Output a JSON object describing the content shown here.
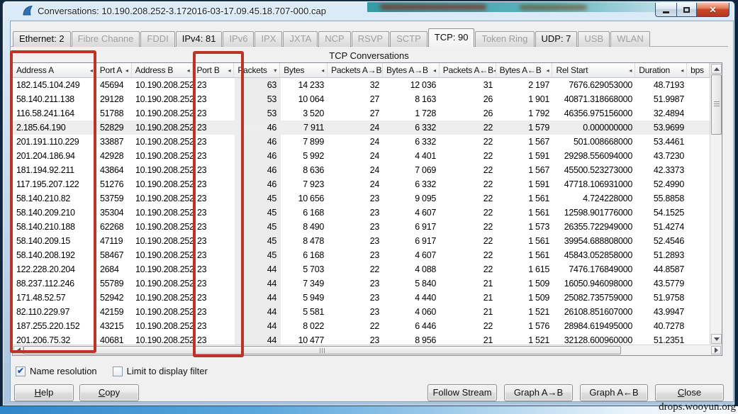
{
  "window": {
    "title": "Conversations: 10.190.208.252-3.172016-03-17.09.45.18.707-000.cap",
    "watermark": "drops.wooyun.org"
  },
  "tabs": [
    {
      "label": "Ethernet: 2",
      "state": "enabled"
    },
    {
      "label": "Fibre Channe",
      "state": "disabled"
    },
    {
      "label": "FDDI",
      "state": "disabled"
    },
    {
      "label": "IPv4: 81",
      "state": "enabled"
    },
    {
      "label": "IPv6",
      "state": "disabled"
    },
    {
      "label": "IPX",
      "state": "disabled"
    },
    {
      "label": "JXTA",
      "state": "disabled"
    },
    {
      "label": "NCP",
      "state": "disabled"
    },
    {
      "label": "RSVP",
      "state": "disabled"
    },
    {
      "label": "SCTP",
      "state": "disabled"
    },
    {
      "label": "TCP: 90",
      "state": "active"
    },
    {
      "label": "Token Ring",
      "state": "disabled"
    },
    {
      "label": "UDP: 7",
      "state": "enabled"
    },
    {
      "label": "USB",
      "state": "disabled"
    },
    {
      "label": "WLAN",
      "state": "disabled"
    }
  ],
  "panel": {
    "caption": "TCP Conversations"
  },
  "table": {
    "columns": [
      {
        "label": "Address A",
        "arrow": "◂"
      },
      {
        "label": "Port A",
        "arrow": "◂"
      },
      {
        "label": "Address B",
        "arrow": "◂"
      },
      {
        "label": "Port B",
        "arrow": "◂"
      },
      {
        "label": "Packets",
        "arrow": "▾"
      },
      {
        "label": "Bytes",
        "arrow": "◂"
      },
      {
        "label": "Packets A→B",
        "arrow": "◂"
      },
      {
        "label": "Bytes A→B",
        "arrow": "◂"
      },
      {
        "label": "Packets A←B",
        "arrow": "◂"
      },
      {
        "label": "Bytes A←B",
        "arrow": "◂"
      },
      {
        "label": "Rel Start",
        "arrow": "◂"
      },
      {
        "label": "Duration",
        "arrow": "◂"
      },
      {
        "label": "bps",
        "arrow": ""
      }
    ],
    "sorted_column_index": 4,
    "highlight_row_index": 3,
    "rows": [
      [
        "182.145.104.249",
        "45694",
        "10.190.208.252",
        "23",
        "63",
        "14 233",
        "32",
        "12 036",
        "31",
        "2 197",
        "7676.629053000",
        "48.7193"
      ],
      [
        "58.140.211.138",
        "29128",
        "10.190.208.252",
        "23",
        "53",
        "10 064",
        "27",
        "8 163",
        "26",
        "1 901",
        "40871.318668000",
        "51.9987"
      ],
      [
        "116.58.241.164",
        "51788",
        "10.190.208.252",
        "23",
        "53",
        "3 520",
        "27",
        "1 728",
        "26",
        "1 792",
        "46356.975156000",
        "32.4894"
      ],
      [
        "2.185.64.190",
        "52829",
        "10.190.208.252",
        "23",
        "46",
        "7 911",
        "24",
        "6 332",
        "22",
        "1 579",
        "0.000000000",
        "53.9699"
      ],
      [
        "201.191.110.229",
        "33887",
        "10.190.208.252",
        "23",
        "46",
        "7 899",
        "24",
        "6 332",
        "22",
        "1 567",
        "501.008668000",
        "53.4461"
      ],
      [
        "201.204.186.94",
        "42928",
        "10.190.208.252",
        "23",
        "46",
        "5 992",
        "24",
        "4 401",
        "22",
        "1 591",
        "29298.556094000",
        "43.7230"
      ],
      [
        "181.194.92.211",
        "43864",
        "10.190.208.252",
        "23",
        "46",
        "8 636",
        "24",
        "7 069",
        "22",
        "1 567",
        "45500.523273000",
        "42.3373"
      ],
      [
        "117.195.207.122",
        "51276",
        "10.190.208.252",
        "23",
        "46",
        "7 923",
        "24",
        "6 332",
        "22",
        "1 591",
        "47718.106931000",
        "52.4990"
      ],
      [
        "58.140.210.82",
        "53759",
        "10.190.208.252",
        "23",
        "45",
        "10 656",
        "23",
        "9 095",
        "22",
        "1 561",
        "4.724228000",
        "55.8858"
      ],
      [
        "58.140.209.210",
        "35304",
        "10.190.208.252",
        "23",
        "45",
        "6 168",
        "23",
        "4 607",
        "22",
        "1 561",
        "12598.901776000",
        "54.1525"
      ],
      [
        "58.140.210.188",
        "62268",
        "10.190.208.252",
        "23",
        "45",
        "8 490",
        "23",
        "6 917",
        "22",
        "1 573",
        "26355.722949000",
        "51.4274"
      ],
      [
        "58.140.209.15",
        "47119",
        "10.190.208.252",
        "23",
        "45",
        "8 478",
        "23",
        "6 917",
        "22",
        "1 561",
        "39954.688808000",
        "52.4546"
      ],
      [
        "58.140.208.192",
        "58467",
        "10.190.208.252",
        "23",
        "45",
        "6 168",
        "23",
        "4 607",
        "22",
        "1 561",
        "45843.052858000",
        "51.2893"
      ],
      [
        "122.228.20.204",
        "2684",
        "10.190.208.252",
        "23",
        "44",
        "5 703",
        "22",
        "4 088",
        "22",
        "1 615",
        "7476.176849000",
        "44.8587"
      ],
      [
        "88.237.112.246",
        "55789",
        "10.190.208.252",
        "23",
        "44",
        "7 349",
        "23",
        "5 840",
        "21",
        "1 509",
        "16050.946098000",
        "43.5779"
      ],
      [
        "171.48.52.57",
        "52942",
        "10.190.208.252",
        "23",
        "44",
        "5 949",
        "23",
        "4 440",
        "21",
        "1 509",
        "25082.735759000",
        "51.9758"
      ],
      [
        "82.110.229.97",
        "42159",
        "10.190.208.252",
        "23",
        "44",
        "5 581",
        "23",
        "4 060",
        "21",
        "1 521",
        "26108.851607000",
        "43.9947"
      ],
      [
        "187.255.220.152",
        "43215",
        "10.190.208.252",
        "23",
        "44",
        "8 022",
        "22",
        "6 446",
        "22",
        "1 576",
        "28984.619495000",
        "40.7278"
      ],
      [
        "201.206.75.32",
        "40681",
        "10.190.208.252",
        "23",
        "44",
        "10 477",
        "23",
        "8 956",
        "21",
        "1 521",
        "32128.600960000",
        "51.2351"
      ]
    ]
  },
  "footer": {
    "checkboxes": [
      {
        "label": "Name resolution",
        "checked": true
      },
      {
        "label": "Limit to display filter",
        "checked": false
      }
    ],
    "buttons": [
      {
        "id": "help",
        "label": "Help",
        "accel": 0
      },
      {
        "id": "copy",
        "label": "Copy",
        "accel": 0
      },
      {
        "id": "follow",
        "label": "Follow Stream",
        "accel": -1
      },
      {
        "id": "graphab",
        "label": "Graph A→B",
        "accel": -1
      },
      {
        "id": "graphba",
        "label": "Graph A←B",
        "accel": -1
      },
      {
        "id": "closeb",
        "label": "Close",
        "accel": 0
      }
    ]
  },
  "colors": {
    "annotation_red": "#bb3425",
    "background_teal": "#29979f",
    "sorted_column_gray": "#ececec",
    "checkbox_blue": "#2059a8"
  }
}
